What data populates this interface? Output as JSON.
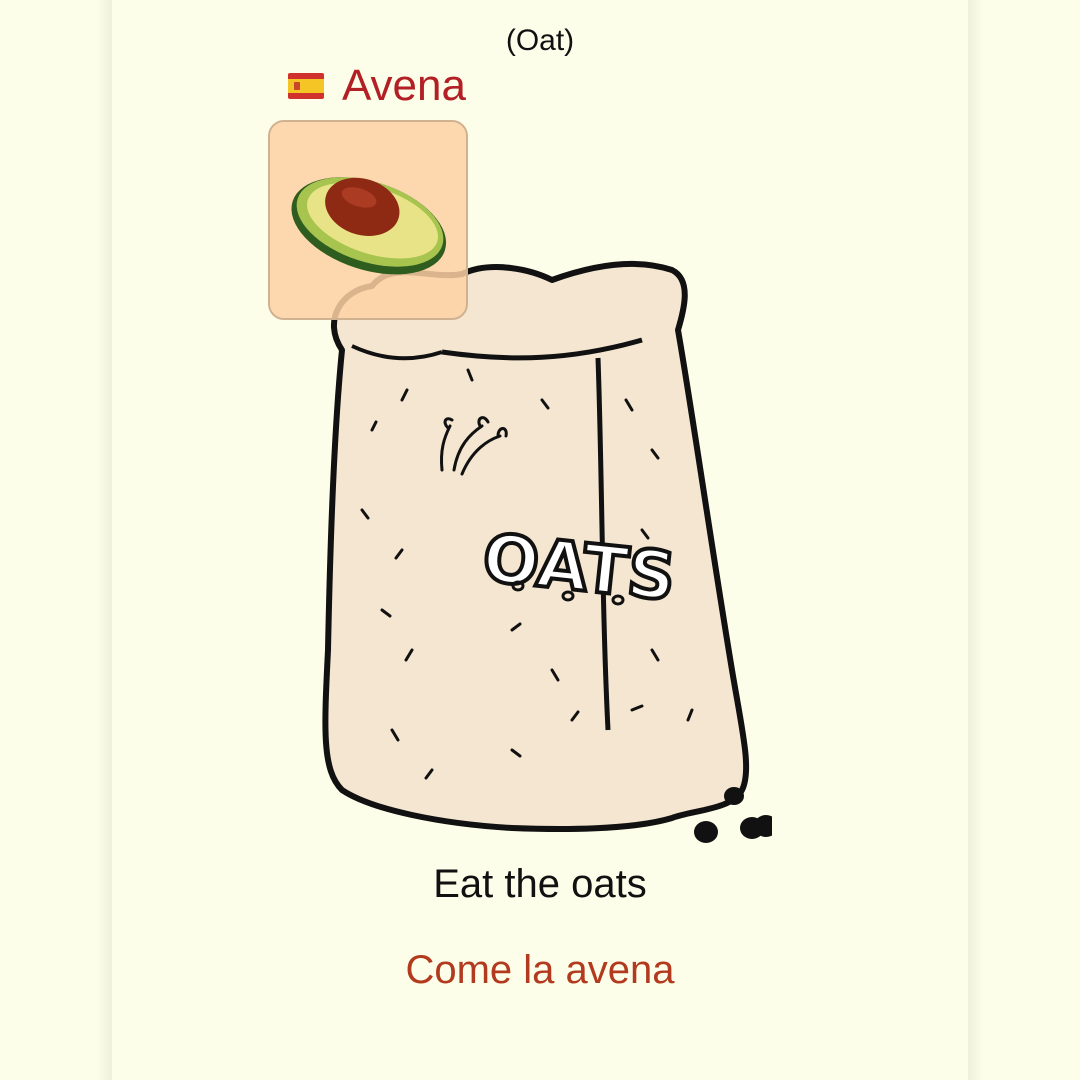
{
  "card": {
    "translation_hint": "(Oat)",
    "language_flag_icon": "spain-flag-icon",
    "word": "Avena",
    "thumbnail_icon": "avocado-icon",
    "illustration": "oats-bag-illustration",
    "sentence_english": "Eat the oats",
    "sentence_spanish": "Come la avena"
  },
  "colors": {
    "background": "#fdfee9",
    "word": "#b21f24",
    "sentence_spanish": "#b23a1e",
    "thumbnail_bg": "#fdd1a3"
  }
}
